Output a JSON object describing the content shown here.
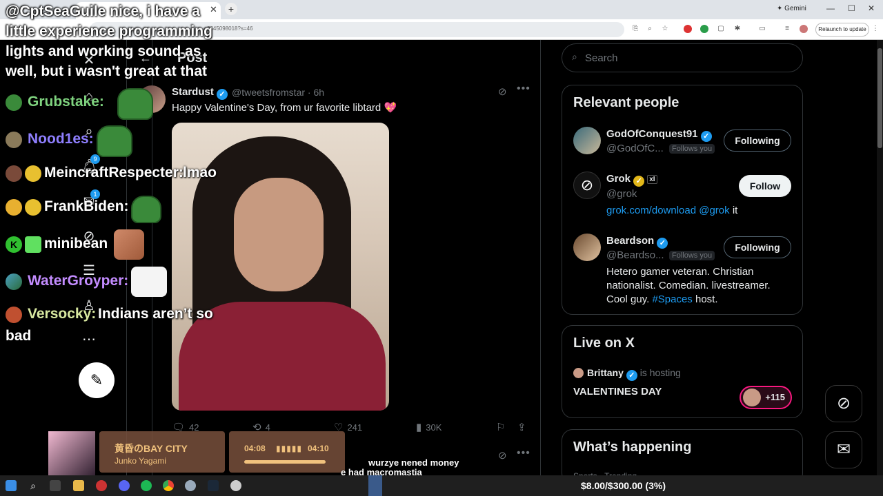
{
  "browser": {
    "tab_close": "✕",
    "new_tab": "+",
    "gemini_label": "Gemini",
    "url": "3345098018?s=46",
    "relaunch_label": "Relaunch to update",
    "minimize": "—",
    "maximize": "☐",
    "close": "✕"
  },
  "x_nav": {
    "notifications_badge": "9",
    "messages_badge": "1"
  },
  "post_header": {
    "title": "Post"
  },
  "post": {
    "author_name": "Stardust",
    "author_handle": "@tweetsfromstar · 6h",
    "text": "Happy Valentine's Day, from ur favorite libtard 💖",
    "replies": "42",
    "reposts": "4",
    "likes": "241",
    "views": "30K"
  },
  "sidebar": {
    "search_placeholder": "Search",
    "relevant_title": "Relevant people",
    "people": [
      {
        "name": "GodOfConquest91",
        "handle": "@GodOfC...",
        "follows_you": "Follows you",
        "button": "Following"
      },
      {
        "name": "Grok",
        "handle": "@grok",
        "badge": "xI",
        "bio_link": "grok.com/download @grok",
        "bio_tail": " it",
        "button": "Follow"
      },
      {
        "name": "Beardson",
        "handle": "@Beardso...",
        "follows_you": "Follows you",
        "button": "Following",
        "bio_pre": "Hetero gamer veteran. Christian nationalist. Comedian. livestreamer. Cool guy. ",
        "bio_hashtag": "#Spaces",
        "bio_post": " host."
      }
    ],
    "live_title": "Live on X",
    "live_host": "Brittany",
    "live_host_tag": "is hosting",
    "live_space_title": "VALENTINES DAY",
    "live_listeners": "+115",
    "happening_title": "What’s happening",
    "happening_sub": "Sports · Trending"
  },
  "overlay": {
    "top_line1": "@CptSeaGuile nice, i have a",
    "top_line2": "little experience programming",
    "top_line3": "lights and working sound as",
    "top_line4": "well, but i wasn't great at that",
    "chat": [
      {
        "name": "Grubstake:",
        "color": "#7fd37f",
        "msg": ""
      },
      {
        "name": "Nood1es:",
        "color": "#8f7fff",
        "msg": ""
      },
      {
        "name": "MeincraftRespecter:",
        "color": "#ffffff",
        "msg": "lmao"
      },
      {
        "name": "FrankBiden:",
        "color": "#ffffff",
        "msg": ""
      },
      {
        "name": "minibean",
        "color": "#ffffff",
        "msg": ""
      },
      {
        "name": "WaterGroyper:",
        "color": "#c38cff",
        "msg": ""
      },
      {
        "name": "Versocky:",
        "color": "#d8e8a0",
        "msg": "Indians aren’t so",
        "msg2": "bad"
      }
    ],
    "song_title": "黄昏のBAY CITY",
    "song_artist": "Junko Yagami",
    "time_current": "04:08",
    "time_total": "04:10",
    "song_progress": 0.98,
    "bottom_line1": "wurzye nened money",
    "bottom_line2": "e had macromastia",
    "donation": "$8.00/$300.00 (3%)"
  }
}
